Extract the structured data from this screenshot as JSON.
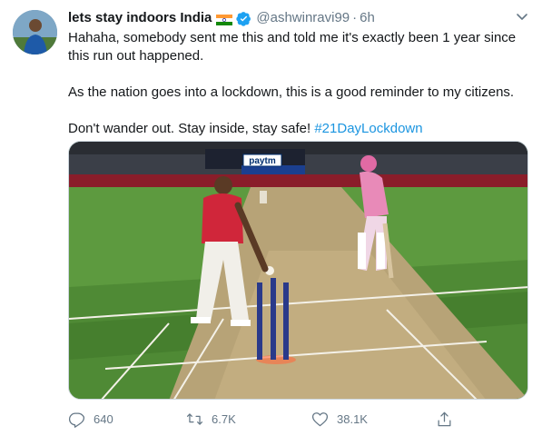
{
  "tweet": {
    "display_name": "lets stay indoors India",
    "flag_icon": "india-flag-icon",
    "verified_icon": "verified-badge-icon",
    "handle": "@ashwinravi99",
    "separator": "·",
    "time": "6h",
    "text_line1": "Hahaha, somebody sent me this and told me it's exactly been 1 year since this run out happened.",
    "text_line2": "As the nation goes into a lockdown, this is a good reminder to my citizens.",
    "text_line3_prefix": "Don't wander out. Stay inside, stay safe! ",
    "hashtag": "#21DayLockdown",
    "colors": {
      "link": "#1b95e0",
      "secondary": "#657786",
      "verified": "#1da1f2"
    }
  },
  "media": {
    "sponsor_text": "paytm",
    "description_icon": "cricket-photo"
  },
  "actions": {
    "reply_count": "640",
    "retweet_count": "6.7K",
    "like_count": "38.1K"
  }
}
